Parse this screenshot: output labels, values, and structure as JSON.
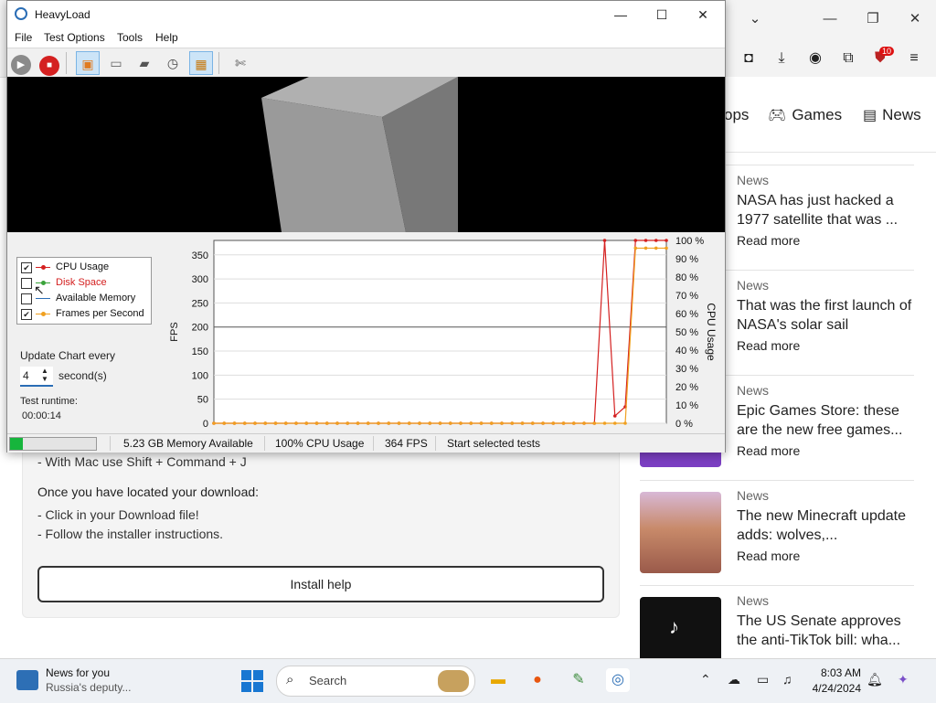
{
  "browser": {
    "nav_partial": "ops",
    "nav_games": "Games",
    "nav_news": "News",
    "ext_badge": "10"
  },
  "news": [
    {
      "category": "News",
      "title": "NASA has just hacked a 1977 satellite that was ...",
      "more": "Read more"
    },
    {
      "category": "News",
      "title": "That was the first launch of NASA's solar sail",
      "more": "Read more"
    },
    {
      "category": "News",
      "title": "Epic Games Store: these are the new free games...",
      "more": "Read more"
    },
    {
      "category": "News",
      "title": "The new Minecraft update adds: wolves,...",
      "more": "Read more"
    },
    {
      "category": "News",
      "title": "The US Senate approves the anti-TikTok bill: wha...",
      "more": "Read more"
    }
  ],
  "page": {
    "mac_line": "- With Mac use Shift + Command + J",
    "located_heading": "Once you have located your download:",
    "step1": "- Click in your Download file!",
    "step2": "- Follow the installer instructions.",
    "install_button": "Install help"
  },
  "heavyload": {
    "title": "HeavyLoad",
    "menu": [
      "File",
      "Test Options",
      "Tools",
      "Help"
    ],
    "legend": [
      {
        "label": "CPU Usage",
        "checked": true,
        "color": "#d42020"
      },
      {
        "label": "Disk Space",
        "checked": false,
        "color": "#3aa33a"
      },
      {
        "label": "Available Memory",
        "checked": false,
        "color": "#2a6db5"
      },
      {
        "label": "Frames per Second",
        "checked": true,
        "color": "#f0a020"
      }
    ],
    "update_label": "Update Chart every",
    "interval": "4",
    "seconds_label": "second(s)",
    "runtime_label": "Test runtime:",
    "runtime": "00:00:14",
    "status": {
      "progress": 0.15,
      "memory": "5.23 GB Memory Available",
      "cpu": "100% CPU Usage",
      "fps": "364 FPS",
      "action": "Start selected tests"
    }
  },
  "chart_data": {
    "type": "line",
    "ylabel": "FPS",
    "y2label": "CPU Usage",
    "ylim": [
      0,
      380
    ],
    "y2lim": [
      0,
      100
    ],
    "y_ticks": [
      0,
      50,
      100,
      150,
      200,
      250,
      300,
      350
    ],
    "y2_ticks": [
      "0 %",
      "10 %",
      "20 %",
      "30 %",
      "40 %",
      "50 %",
      "60 %",
      "70 %",
      "80 %",
      "90 %",
      "100 %"
    ],
    "x_count": 45,
    "series": [
      {
        "name": "CPU Usage",
        "axis": "right",
        "color": "#d42020",
        "values": [
          0,
          0,
          0,
          0,
          0,
          0,
          0,
          0,
          0,
          0,
          0,
          0,
          0,
          0,
          0,
          0,
          0,
          0,
          0,
          0,
          0,
          0,
          0,
          0,
          0,
          0,
          0,
          0,
          0,
          0,
          0,
          0,
          0,
          0,
          0,
          0,
          0,
          0,
          100,
          4,
          9,
          100,
          100,
          100,
          100
        ]
      },
      {
        "name": "Frames per Second",
        "axis": "left",
        "color": "#f0a020",
        "values": [
          0,
          0,
          0,
          0,
          0,
          0,
          0,
          0,
          0,
          0,
          0,
          0,
          0,
          0,
          0,
          0,
          0,
          0,
          0,
          0,
          0,
          0,
          0,
          0,
          0,
          0,
          0,
          0,
          0,
          0,
          0,
          0,
          0,
          0,
          0,
          0,
          0,
          0,
          0,
          0,
          0,
          364,
          364,
          364,
          364
        ]
      }
    ]
  },
  "taskbar": {
    "widget_title": "News for you",
    "widget_sub": "Russia's deputy...",
    "search": "Search",
    "time": "8:03 AM",
    "date": "4/24/2024"
  }
}
